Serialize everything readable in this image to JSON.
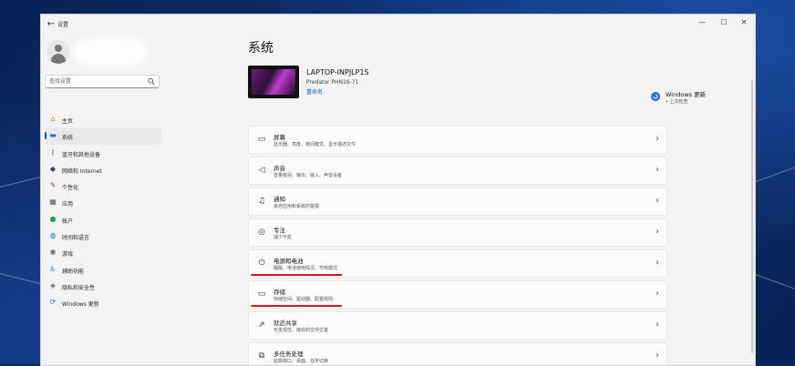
{
  "window": {
    "title": "设置",
    "back_glyph": "←",
    "controls": {
      "minimize": "—",
      "maximize": "☐",
      "close": "✕"
    }
  },
  "sidebar": {
    "search": {
      "placeholder": "查找设置"
    },
    "items": [
      {
        "label": "主页",
        "icon": "home-icon",
        "glyph": "⌂",
        "color": "#d8782b",
        "active": false
      },
      {
        "label": "系统",
        "icon": "display-icon",
        "glyph": "▬",
        "color": "#1f6fd1",
        "active": true
      },
      {
        "label": "蓝牙和其他设备",
        "icon": "bluetooth-icon",
        "glyph": "ᛒ",
        "color": "#1f6fd1",
        "active": false
      },
      {
        "label": "网络和 Internet",
        "icon": "network-icon",
        "glyph": "◆",
        "color": "#3a3a8c",
        "active": false
      },
      {
        "label": "个性化",
        "icon": "brush-icon",
        "glyph": "✎",
        "color": "#c24a2a",
        "active": false
      },
      {
        "label": "应用",
        "icon": "apps-icon",
        "glyph": "▦",
        "color": "#5a5a5a",
        "active": false
      },
      {
        "label": "帐户",
        "icon": "account-icon",
        "glyph": "●",
        "color": "#2a9a5a",
        "active": false
      },
      {
        "label": "时间和语言",
        "icon": "globe-clock-icon",
        "glyph": "◍",
        "color": "#1f6fd1",
        "active": false
      },
      {
        "label": "游戏",
        "icon": "game-icon",
        "glyph": "◉",
        "color": "#6a6a6a",
        "active": false
      },
      {
        "label": "辅助功能",
        "icon": "accessibility-icon",
        "glyph": "♿",
        "color": "#1f6fd1",
        "active": false
      },
      {
        "label": "隐私和安全性",
        "icon": "shield-icon",
        "glyph": "◈",
        "color": "#6a6a6a",
        "active": false
      },
      {
        "label": "Windows 更新",
        "icon": "windows-update-icon",
        "glyph": "⟳",
        "color": "#1f6fd1",
        "active": false
      }
    ]
  },
  "main": {
    "title": "系统",
    "device": {
      "name": "LAPTOP-INPJLP1S",
      "model": "Predator PHN16-71",
      "rename": "重命名"
    },
    "windows_update": {
      "title": "Windows 更新",
      "subtitle": "• 上次检查"
    },
    "rows": [
      {
        "title": "屏幕",
        "subtitle": "显示器、亮度、夜间模式、显示描述文件",
        "icon": "monitor-icon",
        "glyph": "▭",
        "underline": false
      },
      {
        "title": "声音",
        "subtitle": "音量级别、输出、输入、声音设备",
        "icon": "speaker-icon",
        "glyph": "◁",
        "underline": false
      },
      {
        "title": "通知",
        "subtitle": "来自应用和系统的警报",
        "icon": "bell-icon",
        "glyph": "♫",
        "underline": false
      },
      {
        "title": "专注",
        "subtitle": "减少干扰",
        "icon": "focus-icon",
        "glyph": "◎",
        "underline": false
      },
      {
        "title": "电源和电池",
        "subtitle": "睡眠、电池使用情况、节电模式",
        "icon": "power-icon",
        "glyph": "⏻",
        "underline": true
      },
      {
        "title": "存储",
        "subtitle": "存储空间、驱动器、配置规则",
        "icon": "storage-icon",
        "glyph": "▭",
        "underline": true
      },
      {
        "title": "就近共享",
        "subtitle": "可发现性、接收的文件位置",
        "icon": "share-icon",
        "glyph": "⇗",
        "underline": false
      },
      {
        "title": "多任务处理",
        "subtitle": "贴靠窗口、桌面、任务切换",
        "icon": "multitask-icon",
        "glyph": "⧉",
        "underline": false
      }
    ],
    "chevron": "›"
  },
  "annotation_color": "#cf1d1d"
}
